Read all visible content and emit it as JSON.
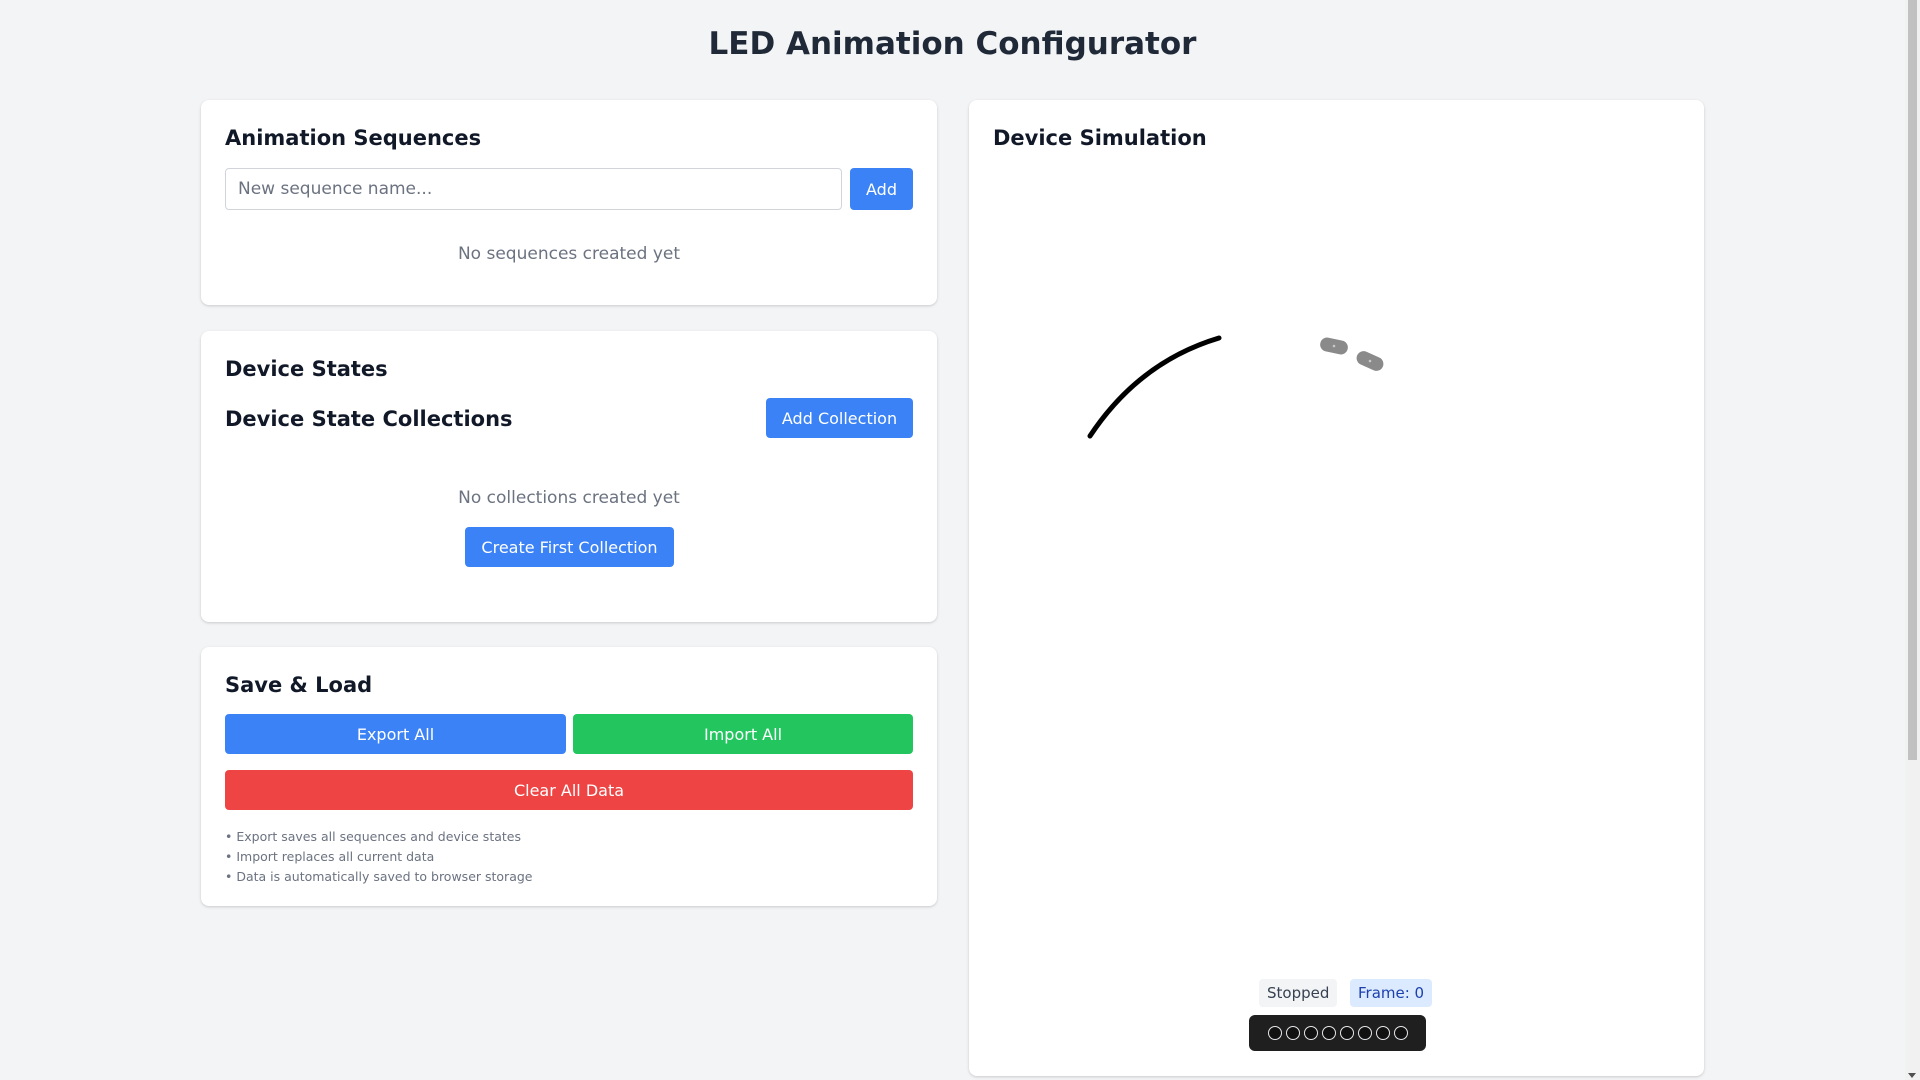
{
  "page": {
    "title": "LED Animation Configurator"
  },
  "sequences": {
    "title": "Animation Sequences",
    "input_placeholder": "New sequence name...",
    "add_label": "Add",
    "empty_text": "No sequences created yet"
  },
  "device_states": {
    "title": "Device States",
    "collections_title": "Device State Collections",
    "add_collection_label": "Add Collection",
    "empty_text": "No collections created yet",
    "create_first_label": "Create First Collection"
  },
  "save_load": {
    "title": "Save & Load",
    "export_label": "Export All",
    "import_label": "Import All",
    "clear_label": "Clear All Data",
    "notes": [
      "• Export saves all sequences and device states",
      "• Import replaces all current data",
      "• Data is automatically saved to browser storage"
    ]
  },
  "simulation": {
    "title": "Device Simulation",
    "status": "Stopped",
    "frame_label": "Frame: 0",
    "led_count": 8
  },
  "colors": {
    "blue": "#3b82f6",
    "green": "#22c55e",
    "red": "#ef4444",
    "background": "#f3f4f6"
  }
}
